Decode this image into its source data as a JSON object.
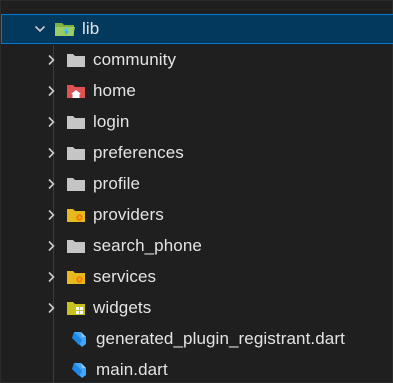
{
  "tree": {
    "root": {
      "label": "lib",
      "icon": "folder-open-green-icon",
      "expanded": true
    },
    "items": [
      {
        "label": "community",
        "icon": "folder-icon",
        "type": "folder",
        "color": "#c5c5c5"
      },
      {
        "label": "home",
        "icon": "folder-home-icon",
        "type": "folder",
        "color": "#e05252"
      },
      {
        "label": "login",
        "icon": "folder-icon",
        "type": "folder",
        "color": "#c5c5c5"
      },
      {
        "label": "preferences",
        "icon": "folder-icon",
        "type": "folder",
        "color": "#c5c5c5"
      },
      {
        "label": "profile",
        "icon": "folder-icon",
        "type": "folder",
        "color": "#c5c5c5"
      },
      {
        "label": "providers",
        "icon": "folder-providers-icon",
        "type": "folder",
        "color": "#e8b91f"
      },
      {
        "label": "search_phone",
        "icon": "folder-icon",
        "type": "folder",
        "color": "#c5c5c5"
      },
      {
        "label": "services",
        "icon": "folder-services-icon",
        "type": "folder",
        "color": "#e8b91f"
      },
      {
        "label": "widgets",
        "icon": "folder-widgets-icon",
        "type": "folder",
        "color": "#c9c21e"
      },
      {
        "label": "generated_plugin_registrant.dart",
        "icon": "dart-file-icon",
        "type": "file",
        "color": "#42a5f5"
      },
      {
        "label": "main.dart",
        "icon": "dart-file-icon",
        "type": "file",
        "color": "#42a5f5"
      }
    ]
  },
  "colors": {
    "background": "#1f1f1f",
    "selection": "#04395e",
    "selection_border": "#0078d4"
  }
}
